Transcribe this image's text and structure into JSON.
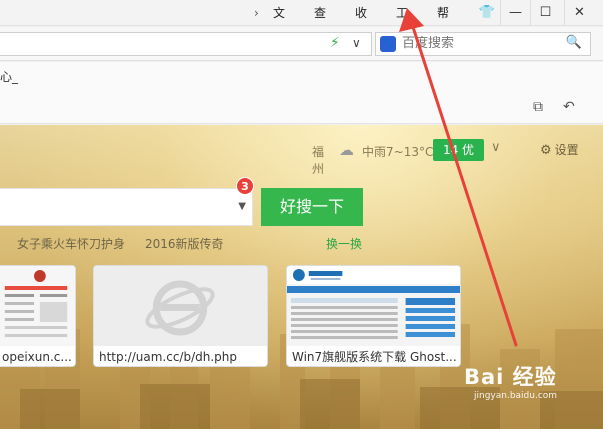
{
  "menu": {
    "items": [
      "文件",
      "查看",
      "收藏",
      "工具",
      "帮助"
    ]
  },
  "address": {
    "search_placeholder": "百度搜索"
  },
  "bookmarks": {
    "item": "心_"
  },
  "weather": {
    "city": "福州",
    "temp": "中雨7~13°C",
    "aqi": "14 优"
  },
  "settings_label": "设置",
  "search": {
    "badge": "3",
    "button": "好搜一下"
  },
  "hot_words": [
    "女子乘火车怀刀护身",
    "2016新版传奇"
  ],
  "change_label": "换一换",
  "tiles": [
    {
      "caption": "opeixun.c..."
    },
    {
      "caption": "http://uam.cc/b/dh.php"
    },
    {
      "caption": "Win7旗舰版系统下载 Ghost..."
    }
  ],
  "watermark": {
    "logo": "Bai 经验",
    "sub": "jingyan.baidu.com"
  },
  "colors": {
    "accent_green": "#36b74e",
    "badge_red": "#e8413a",
    "arrow_red": "#e8413a"
  }
}
